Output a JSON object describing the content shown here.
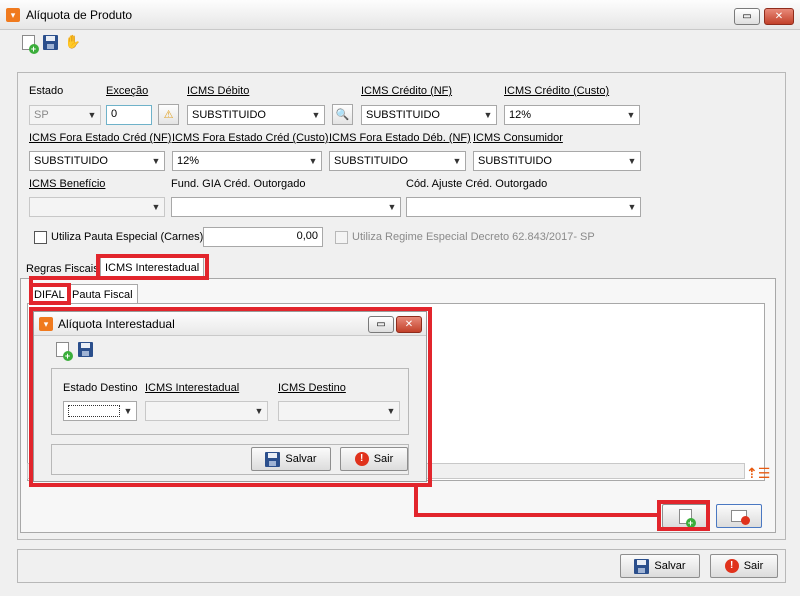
{
  "window": {
    "title": "Alíquota de Produto"
  },
  "colors": {
    "accent": "#f07a1e",
    "highlight": "#e2252c"
  },
  "form": {
    "estado": {
      "label": "Estado",
      "value": "SP"
    },
    "excecao": {
      "label": "Exceção",
      "value": "0"
    },
    "icms_debito": {
      "label": "ICMS Débito",
      "value": "SUBSTITUIDO"
    },
    "icms_credito_nf": {
      "label": "ICMS Crédito (NF)",
      "value": "SUBSTITUIDO"
    },
    "icms_credito_custo": {
      "label": "ICMS Crédito (Custo)",
      "value": "12%"
    },
    "icms_fora_estado_cred_nf": {
      "label": "ICMS Fora Estado Créd (NF)",
      "value": "SUBSTITUIDO"
    },
    "icms_fora_estado_cred_custo": {
      "label": "ICMS Fora Estado Créd (Custo)",
      "value": "12%"
    },
    "icms_fora_estado_deb_nf": {
      "label": "ICMS Fora Estado Déb. (NF)",
      "value": "SUBSTITUIDO"
    },
    "icms_consumidor": {
      "label": "ICMS Consumidor",
      "value": "SUBSTITUIDO"
    },
    "icms_beneficio": {
      "label": "ICMS Benefício",
      "value": ""
    },
    "fund_gia": {
      "label": "Fund. GIA Créd. Outorgado",
      "value": ""
    },
    "cod_ajuste": {
      "label": "Cód. Ajuste Créd. Outorgado",
      "value": ""
    },
    "pauta_especial": {
      "label": "Utiliza Pauta Especial (Carnes)",
      "value": "0,00"
    },
    "regime_especial": {
      "label": "Utiliza Regime Especial Decreto 62.843/2017- SP"
    }
  },
  "tabs": {
    "main": [
      {
        "label": "Regras Fiscais"
      },
      {
        "label": "ICMS Interestadual"
      }
    ],
    "sub": [
      {
        "label": "DIFAL"
      },
      {
        "label": "Pauta Fiscal"
      }
    ]
  },
  "dialog": {
    "title": "Alíquota Interestadual",
    "estado_destino": {
      "label": "Estado Destino",
      "value": ""
    },
    "icms_interestadual": {
      "label": "ICMS Interestadual",
      "value": ""
    },
    "icms_destino": {
      "label": "ICMS Destino",
      "value": ""
    },
    "save_label": "Salvar",
    "exit_label": "Sair"
  },
  "footer": {
    "save_label": "Salvar",
    "exit_label": "Sair"
  }
}
